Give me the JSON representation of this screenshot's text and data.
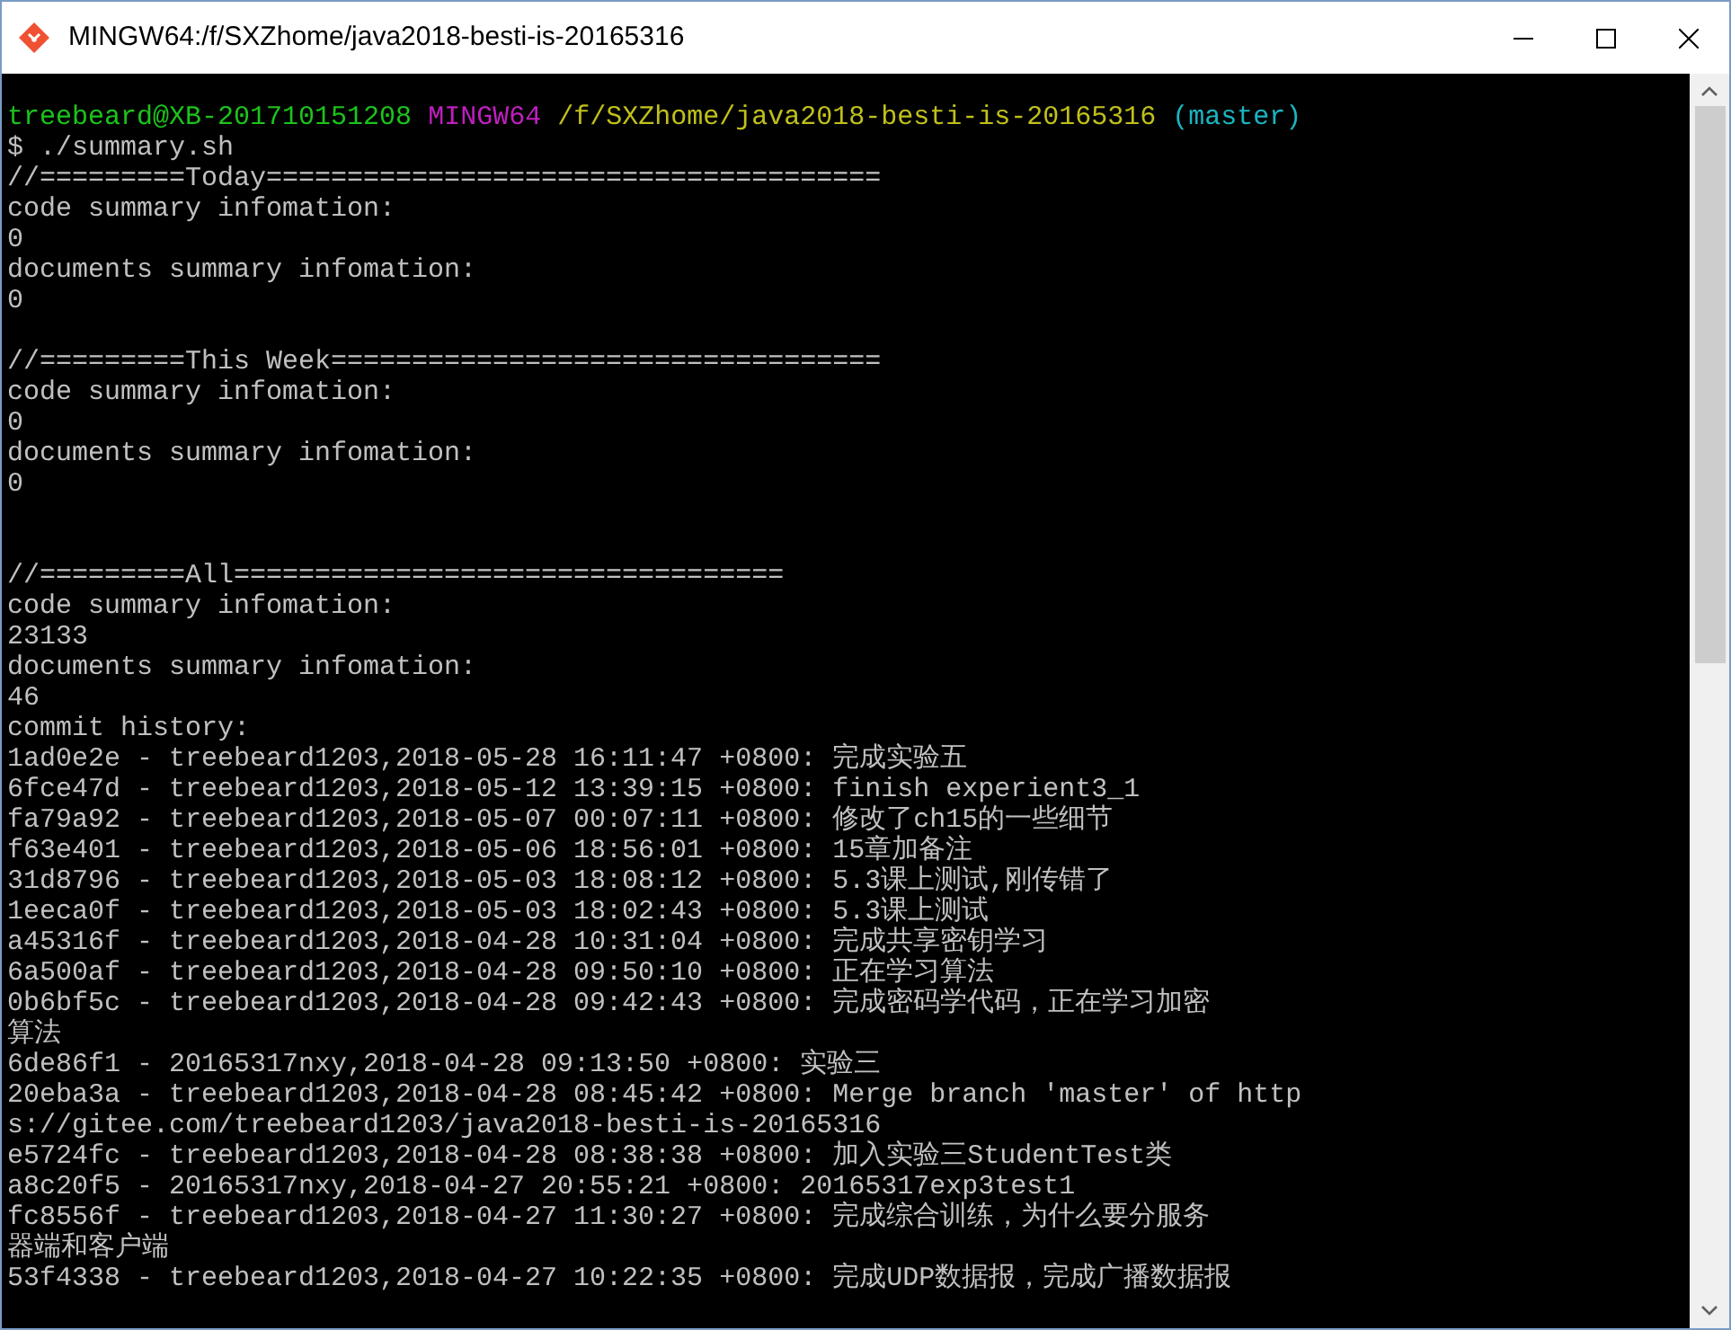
{
  "window": {
    "title": "MINGW64:/f/SXZhome/java2018-besti-is-20165316"
  },
  "terminal": {
    "lines": [
      {
        "kind": "prompt",
        "user_host": "treebeard@XB-201710151208",
        "shell": "MINGW64",
        "path": "/f/SXZhome/java2018-besti-is-20165316",
        "branch": "(master)"
      },
      {
        "kind": "text",
        "text": "$ ./summary.sh"
      },
      {
        "kind": "text",
        "text": "//=========Today======================================"
      },
      {
        "kind": "text",
        "text": "code summary infomation:"
      },
      {
        "kind": "text",
        "text": "0"
      },
      {
        "kind": "text",
        "text": "documents summary infomation:"
      },
      {
        "kind": "text",
        "text": "0"
      },
      {
        "kind": "blank"
      },
      {
        "kind": "text",
        "text": "//=========This Week=================================="
      },
      {
        "kind": "text",
        "text": "code summary infomation:"
      },
      {
        "kind": "text",
        "text": "0"
      },
      {
        "kind": "text",
        "text": "documents summary infomation:"
      },
      {
        "kind": "text",
        "text": "0"
      },
      {
        "kind": "blank"
      },
      {
        "kind": "blank"
      },
      {
        "kind": "text",
        "text": "//=========All=================================="
      },
      {
        "kind": "text",
        "text": "code summary infomation:"
      },
      {
        "kind": "text",
        "text": "23133"
      },
      {
        "kind": "text",
        "text": "documents summary infomation:"
      },
      {
        "kind": "text",
        "text": "46"
      },
      {
        "kind": "text",
        "text": "commit history:"
      },
      {
        "kind": "text",
        "text": "1ad0e2e - treebeard1203,2018-05-28 16:11:47 +0800: 完成实验五"
      },
      {
        "kind": "text",
        "text": "6fce47d - treebeard1203,2018-05-12 13:39:15 +0800: finish experient3_1"
      },
      {
        "kind": "text",
        "text": "fa79a92 - treebeard1203,2018-05-07 00:07:11 +0800: 修改了ch15的一些细节"
      },
      {
        "kind": "text",
        "text": "f63e401 - treebeard1203,2018-05-06 18:56:01 +0800: 15章加备注"
      },
      {
        "kind": "text",
        "text": "31d8796 - treebeard1203,2018-05-03 18:08:12 +0800: 5.3课上测试,刚传错了"
      },
      {
        "kind": "text",
        "text": "1eeca0f - treebeard1203,2018-05-03 18:02:43 +0800: 5.3课上测试"
      },
      {
        "kind": "text",
        "text": "a45316f - treebeard1203,2018-04-28 10:31:04 +0800: 完成共享密钥学习"
      },
      {
        "kind": "text",
        "text": "6a500af - treebeard1203,2018-04-28 09:50:10 +0800: 正在学习算法"
      },
      {
        "kind": "text",
        "text": "0b6bf5c - treebeard1203,2018-04-28 09:42:43 +0800: 完成密码学代码，正在学习加密"
      },
      {
        "kind": "text",
        "text": "算法"
      },
      {
        "kind": "text",
        "text": "6de86f1 - 20165317nxy,2018-04-28 09:13:50 +0800: 实验三"
      },
      {
        "kind": "text",
        "text": "20eba3a - treebeard1203,2018-04-28 08:45:42 +0800: Merge branch 'master' of http"
      },
      {
        "kind": "text",
        "text": "s://gitee.com/treebeard1203/java2018-besti-is-20165316"
      },
      {
        "kind": "text",
        "text": "e5724fc - treebeard1203,2018-04-28 08:38:38 +0800: 加入实验三StudentTest类"
      },
      {
        "kind": "text",
        "text": "a8c20f5 - 20165317nxy,2018-04-27 20:55:21 +0800: 20165317exp3test1"
      },
      {
        "kind": "text",
        "text": "fc8556f - treebeard1203,2018-04-27 11:30:27 +0800: 完成综合训练，为什么要分服务"
      },
      {
        "kind": "text",
        "text": "器端和客户端"
      },
      {
        "kind": "text",
        "text": "53f4338 - treebeard1203,2018-04-27 10:22:35 +0800: 完成UDP数据报，完成广播数据报"
      }
    ]
  }
}
